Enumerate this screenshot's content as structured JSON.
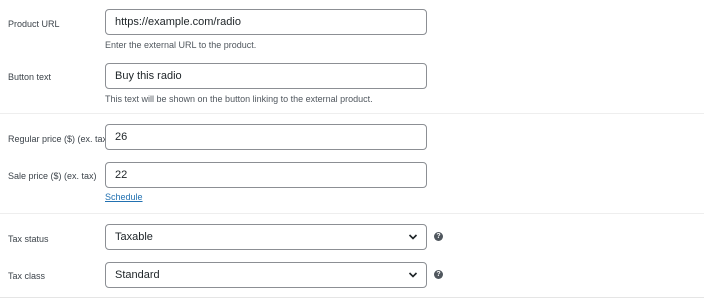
{
  "product_url": {
    "label": "Product URL",
    "value": "https://example.com/radio",
    "help": "Enter the external URL to the product."
  },
  "button_text": {
    "label": "Button text",
    "value": "Buy this radio",
    "help": "This text will be shown on the button linking to the external product."
  },
  "regular_price": {
    "label": "Regular price ($) (ex. tax)",
    "value": "26"
  },
  "sale_price": {
    "label": "Sale price ($) (ex. tax)",
    "value": "22",
    "schedule_link": "Schedule"
  },
  "tax_status": {
    "label": "Tax status",
    "selected": "Taxable",
    "help_icon": "question-icon"
  },
  "tax_class": {
    "label": "Tax class",
    "selected": "Standard",
    "help_icon": "question-icon"
  },
  "colors": {
    "border": "#8c8f94",
    "link": "#2271b1",
    "label": "#3c434a"
  }
}
